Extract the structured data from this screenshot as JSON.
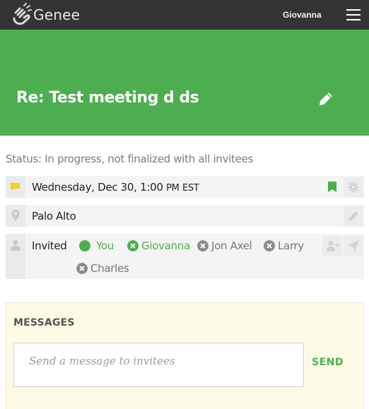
{
  "app": {
    "brand": "Genee",
    "user": "Giovanna",
    "logo_icon": "hand-logo-icon",
    "menu_icon": "hamburger-menu-icon"
  },
  "header": {
    "title": "Re: Test meeting d ds",
    "edit_icon": "pencil-icon",
    "color": "#4cae4f"
  },
  "status": "Status: In progress, not finalized with all invitees",
  "time_row": {
    "date": "Wednesday, Dec 30,",
    "time": "1:00",
    "ampm": "PM",
    "tz": "EST",
    "icon": "message-flag-icon",
    "bookmark_icon": "bookmark-icon",
    "settings_icon": "gear-icon"
  },
  "location_row": {
    "text": "Palo Alto",
    "icon": "map-pin-icon",
    "edit_icon": "pencil-icon"
  },
  "invite_row": {
    "label": "Invited",
    "icon": "person-icon",
    "add_icon": "add-person-icon",
    "send_icon": "paper-plane-icon",
    "invitees": [
      {
        "name": "You",
        "state": "accepted",
        "color": "#4cae4f"
      },
      {
        "name": "Giovanna",
        "state": "declinable",
        "color": "#4cae4f"
      },
      {
        "name": "Jon Axel",
        "state": "pending",
        "color": "#777777"
      },
      {
        "name": "Larry",
        "state": "pending",
        "color": "#777777"
      },
      {
        "name": "Charles",
        "state": "pending",
        "color": "#777777"
      }
    ]
  },
  "messages": {
    "title": "MESSAGES",
    "placeholder": "Send a message to invitees",
    "send_label": "SEND"
  }
}
